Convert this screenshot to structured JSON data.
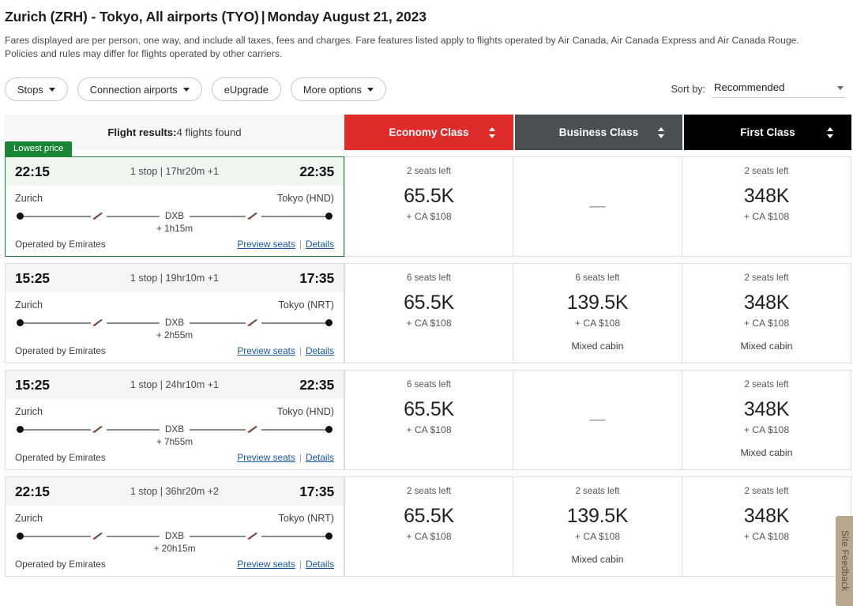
{
  "header": {
    "route": "Zurich (ZRH) - Tokyo, All airports (TYO)",
    "separator": "|",
    "date": "Monday August 21, 2023",
    "description": "Fares displayed are per person, one way, and include all taxes, fees and charges. Fare features listed apply to flights operated by Air Canada, Air Canada Express and Air Canada Rouge. Policies and rules may differ for flights operated by other carriers."
  },
  "filters": {
    "stops": "Stops",
    "connection_airports": "Connection airports",
    "eupgrade": "eUpgrade",
    "more_options": "More options",
    "sort_label": "Sort by:",
    "sort_value": "Recommended"
  },
  "table": {
    "results_label": "Flight results:",
    "results_count": "4 flights found",
    "columns": [
      {
        "label": "Economy Class",
        "color": "#e02b2b"
      },
      {
        "label": "Business Class",
        "color": "#4b4f52"
      },
      {
        "label": "First Class",
        "color": "#000000"
      }
    ]
  },
  "labels": {
    "operated_by": "Operated by Emirates",
    "preview_seats": "Preview seats",
    "details": "Details",
    "pipe": "|",
    "lowest_price": "Lowest price",
    "unavailable": "—"
  },
  "flights": [
    {
      "badge": "Lowest price",
      "depart_time": "22:15",
      "duration": "1 stop | 17hr20m +1",
      "arrive_time": "22:35",
      "origin": "Zurich",
      "destination": "Tokyo (HND)",
      "stop_code": "DXB",
      "layover": "+ 1h15m",
      "operated_by": "Operated by Emirates",
      "fares": [
        {
          "seats": "2 seats left",
          "points": "65.5K",
          "cash": "+ CA $108",
          "mixed": ""
        },
        {
          "seats": "",
          "points": "",
          "cash": "",
          "mixed": "",
          "unavailable": true
        },
        {
          "seats": "2 seats left",
          "points": "348K",
          "cash": "+ CA $108",
          "mixed": ""
        }
      ]
    },
    {
      "badge": "",
      "depart_time": "15:25",
      "duration": "1 stop | 19hr10m +1",
      "arrive_time": "17:35",
      "origin": "Zurich",
      "destination": "Tokyo (NRT)",
      "stop_code": "DXB",
      "layover": "+ 2h55m",
      "operated_by": "Operated by Emirates",
      "fares": [
        {
          "seats": "6 seats left",
          "points": "65.5K",
          "cash": "+ CA $108",
          "mixed": ""
        },
        {
          "seats": "6 seats left",
          "points": "139.5K",
          "cash": "+ CA $108",
          "mixed": "Mixed cabin"
        },
        {
          "seats": "2 seats left",
          "points": "348K",
          "cash": "+ CA $108",
          "mixed": "Mixed cabin"
        }
      ]
    },
    {
      "badge": "",
      "depart_time": "15:25",
      "duration": "1 stop | 24hr10m +1",
      "arrive_time": "22:35",
      "origin": "Zurich",
      "destination": "Tokyo (HND)",
      "stop_code": "DXB",
      "layover": "+ 7h55m",
      "operated_by": "Operated by Emirates",
      "fares": [
        {
          "seats": "6 seats left",
          "points": "65.5K",
          "cash": "+ CA $108",
          "mixed": ""
        },
        {
          "seats": "",
          "points": "",
          "cash": "",
          "mixed": "",
          "unavailable": true
        },
        {
          "seats": "2 seats left",
          "points": "348K",
          "cash": "+ CA $108",
          "mixed": "Mixed cabin"
        }
      ]
    },
    {
      "badge": "",
      "depart_time": "22:15",
      "duration": "1 stop | 36hr20m +2",
      "arrive_time": "17:35",
      "origin": "Zurich",
      "destination": "Tokyo (NRT)",
      "stop_code": "DXB",
      "layover": "+ 20h15m",
      "operated_by": "Operated by Emirates",
      "fares": [
        {
          "seats": "2 seats left",
          "points": "65.5K",
          "cash": "+ CA $108",
          "mixed": ""
        },
        {
          "seats": "2 seats left",
          "points": "139.5K",
          "cash": "+ CA $108",
          "mixed": "Mixed cabin"
        },
        {
          "seats": "2 seats left",
          "points": "348K",
          "cash": "+ CA $108",
          "mixed": ""
        }
      ]
    }
  ],
  "feedback": {
    "label": "Site Feedback"
  }
}
